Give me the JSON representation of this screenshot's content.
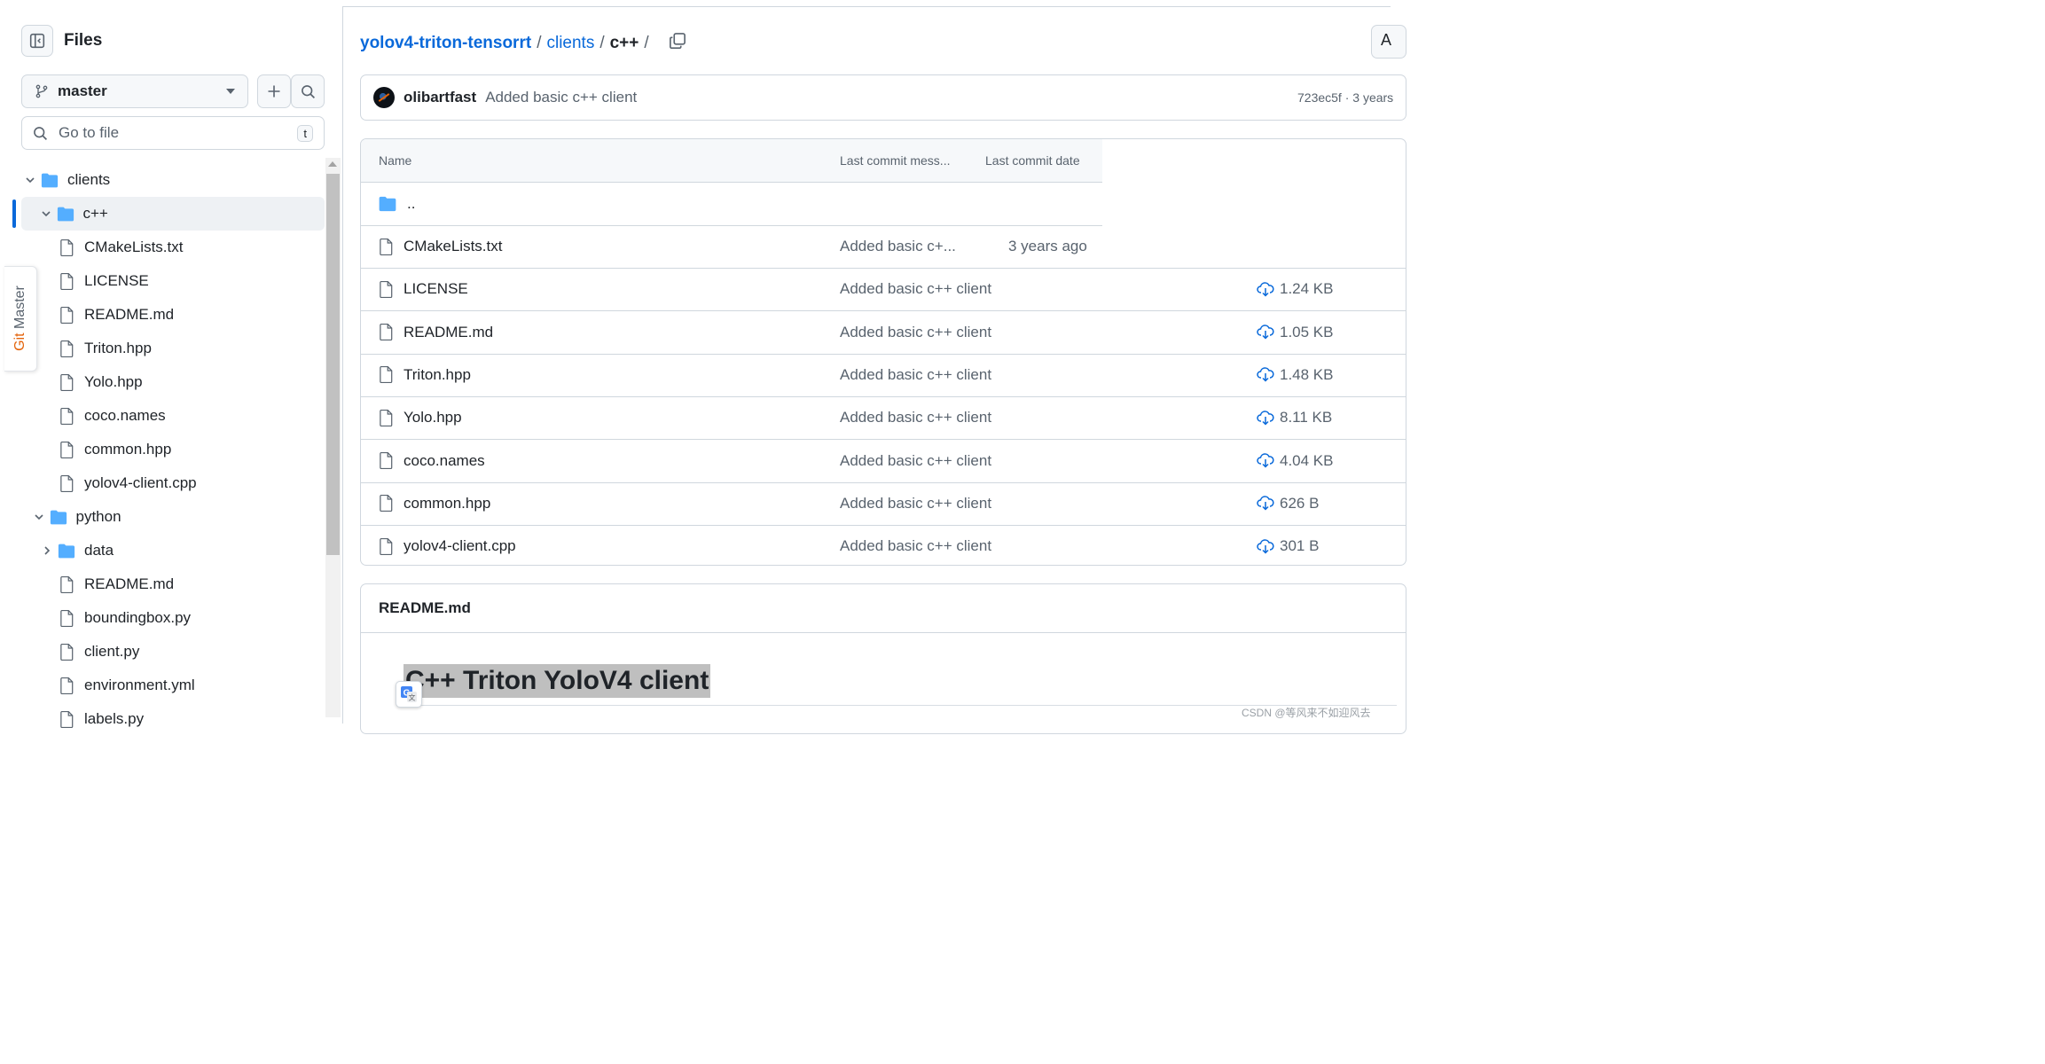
{
  "sidebar": {
    "title": "Files",
    "branch": "master",
    "search_placeholder": "Go to file",
    "search_shortcut": "t",
    "tree": [
      {
        "label": "clients",
        "type": "folder",
        "depth": 0,
        "expanded": true
      },
      {
        "label": "c++",
        "type": "folder",
        "depth": 1,
        "expanded": true,
        "selected": true
      },
      {
        "label": "CMakeLists.txt",
        "type": "file",
        "depth": 2
      },
      {
        "label": "LICENSE",
        "type": "file",
        "depth": 2
      },
      {
        "label": "README.md",
        "type": "file",
        "depth": 2
      },
      {
        "label": "Triton.hpp",
        "type": "file",
        "depth": 2
      },
      {
        "label": "Yolo.hpp",
        "type": "file",
        "depth": 2
      },
      {
        "label": "coco.names",
        "type": "file",
        "depth": 2
      },
      {
        "label": "common.hpp",
        "type": "file",
        "depth": 2
      },
      {
        "label": "yolov4-client.cpp",
        "type": "file",
        "depth": 2
      },
      {
        "label": "python",
        "type": "folder",
        "depth": 1,
        "expanded": true
      },
      {
        "label": "data",
        "type": "folder",
        "depth": 2,
        "expanded": false
      },
      {
        "label": "README.md",
        "type": "file",
        "depth": 2
      },
      {
        "label": "boundingbox.py",
        "type": "file",
        "depth": 2
      },
      {
        "label": "client.py",
        "type": "file",
        "depth": 2
      },
      {
        "label": "environment.yml",
        "type": "file",
        "depth": 2
      },
      {
        "label": "labels.py",
        "type": "file",
        "depth": 2
      }
    ]
  },
  "git_master": {
    "prefix": "Git ",
    "suffix": "Master"
  },
  "breadcrumb": {
    "repo": "yolov4-triton-tensorrt",
    "sep1": "/",
    "folder": "clients",
    "sep2": "/",
    "current": "c++",
    "sep3": "/"
  },
  "top_right_button": "A",
  "commit": {
    "author": "olibartfast",
    "message": "Added basic c++ client",
    "hash_age": "723ec5f · 3 years"
  },
  "table": {
    "headers": {
      "name": "Name",
      "last_commit_message": "Last commit mess...",
      "last_commit_date": "Last commit date"
    },
    "parent_dir": "..",
    "rows": [
      {
        "name": "CMakeLists.txt",
        "commit": "Added basic c+...",
        "date": "3 years ago",
        "size": ""
      },
      {
        "name": "LICENSE",
        "commit": "Added basic c++ client",
        "date": "",
        "size": "1.24 KB"
      },
      {
        "name": "README.md",
        "commit": "Added basic c++ client",
        "date": "",
        "size": "1.05 KB"
      },
      {
        "name": "Triton.hpp",
        "commit": "Added basic c++ client",
        "date": "",
        "size": "1.48 KB"
      },
      {
        "name": "Yolo.hpp",
        "commit": "Added basic c++ client",
        "date": "",
        "size": "8.11 KB"
      },
      {
        "name": "coco.names",
        "commit": "Added basic c++ client",
        "date": "",
        "size": "4.04 KB"
      },
      {
        "name": "common.hpp",
        "commit": "Added basic c++ client",
        "date": "",
        "size": "626 B"
      },
      {
        "name": "yolov4-client.cpp",
        "commit": "Added basic c++ client",
        "date": "",
        "size": "301 B"
      }
    ]
  },
  "readme": {
    "title": "README.md",
    "heading": "C++ Triton YoloV4 client"
  },
  "watermark": "CSDN @等风来不如迎风去",
  "colors": {
    "accent": "#0969da",
    "folder": "#54aeff",
    "border": "#d0d7de",
    "muted": "#59636e"
  }
}
